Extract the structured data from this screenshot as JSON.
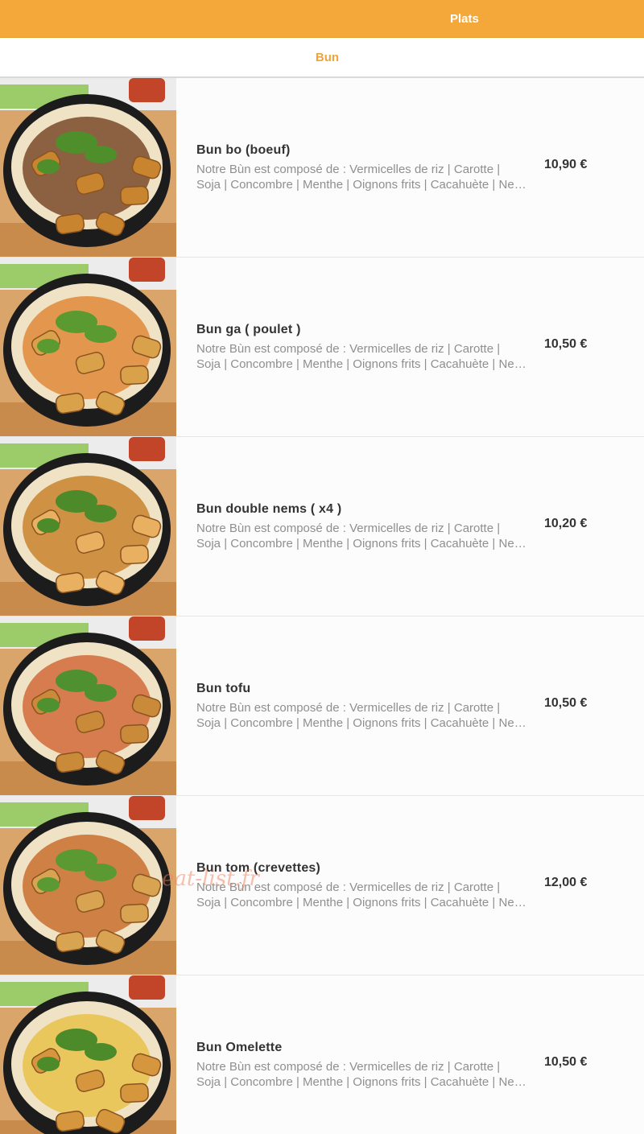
{
  "header": {
    "title": "Plats",
    "accent_color": "#f4a83a"
  },
  "category_tab": {
    "label": "Bun",
    "color": "#f0a33a"
  },
  "items": [
    {
      "name": "Bun bo (boeuf)",
      "desc_line1": "Notre Bùn est composé de : Vermicelles de riz | Carotte |",
      "desc_line2": "Soja | Concombre | Menthe | Oignons frits | Cacahuète | Nem | Sauce",
      "price": "10,90 €",
      "image_icon": "bun-bowl-beef-photo"
    },
    {
      "name": "Bun ga ( poulet )",
      "desc_line1": "Notre Bùn est composé de : Vermicelles de riz | Carotte |",
      "desc_line2": "Soja | Concombre | Menthe | Oignons frits | Cacahuète | Nem | Sauce",
      "price": "10,50 €",
      "image_icon": "bun-bowl-chicken-photo"
    },
    {
      "name": "Bun double nems ( x4 )",
      "desc_line1": "Notre Bùn est composé de : Vermicelles de riz | Carotte |",
      "desc_line2": "Soja | Concombre | Menthe | Oignons frits | Cacahuète | Nem | Sauce",
      "price": "10,20 €",
      "image_icon": "bun-bowl-nems-photo"
    },
    {
      "name": "Bun tofu",
      "desc_line1": "Notre Bùn est composé de : Vermicelles de riz | Carotte |",
      "desc_line2": "Soja | Concombre | Menthe | Oignons frits | Cacahuète | Nem | Sauce",
      "price": "10,50 €",
      "image_icon": "bun-bowl-tofu-photo"
    },
    {
      "name": "Bun tom (crevettes)",
      "desc_line1": "Notre Bùn est composé de : Vermicelles de riz | Carotte |",
      "desc_line2": "Soja | Concombre | Menthe | Oignons frits | Cacahuète | Nem | Sauce",
      "price": "12,00 €",
      "image_icon": "bun-bowl-shrimp-photo"
    },
    {
      "name": "Bun Omelette",
      "desc_line1": "Notre Bùn est composé de : Vermicelles de riz | Carotte |",
      "desc_line2": "Soja | Concombre | Menthe | Oignons frits | Cacahuète | Nem | Sauce",
      "price": "10,50 €",
      "image_icon": "bun-bowl-omelette-photo"
    }
  ],
  "watermark": "eat-list.fr"
}
